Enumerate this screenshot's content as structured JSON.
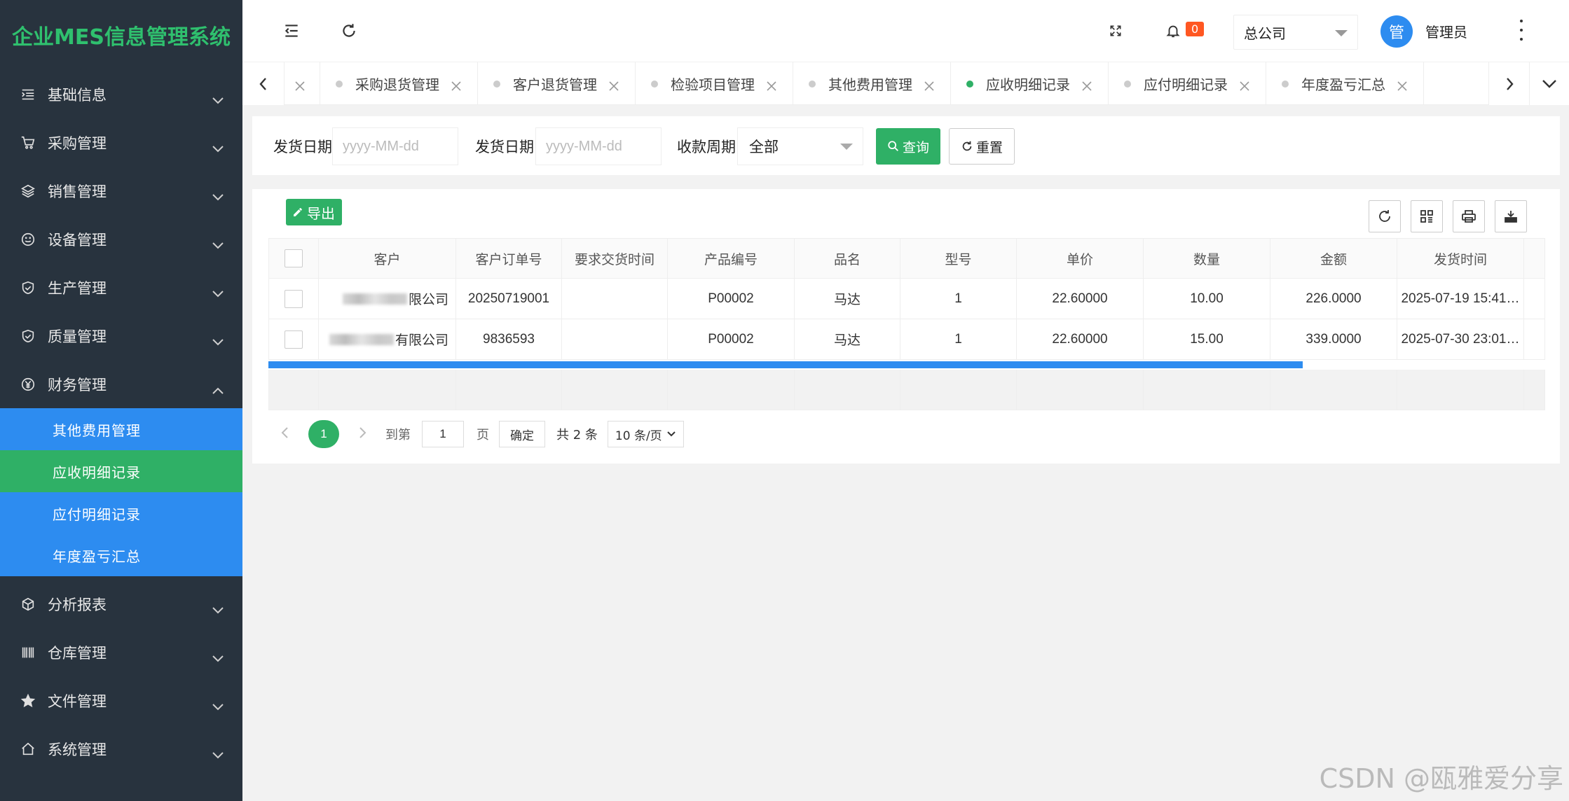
{
  "app": {
    "title": "企业MES信息管理系统"
  },
  "sidebar": {
    "menu_top": [
      {
        "label": "基础信息",
        "icon": "list-indent-icon"
      },
      {
        "label": "采购管理",
        "icon": "cart-icon"
      },
      {
        "label": "销售管理",
        "icon": "layers-icon"
      },
      {
        "label": "设备管理",
        "icon": "smile-icon"
      },
      {
        "label": "生产管理",
        "icon": "shield-check-icon"
      },
      {
        "label": "质量管理",
        "icon": "shield-check-icon"
      },
      {
        "label": "财务管理",
        "icon": "yen-icon"
      }
    ],
    "submenu": [
      {
        "label": "其他费用管理"
      },
      {
        "label": "应收明细记录"
      },
      {
        "label": "应付明细记录"
      },
      {
        "label": "年度盈亏汇总"
      }
    ],
    "menu_bottom": [
      {
        "label": "分析报表",
        "icon": "cube-icon"
      },
      {
        "label": "仓库管理",
        "icon": "barcode-icon"
      },
      {
        "label": "文件管理",
        "icon": "star-icon"
      },
      {
        "label": "系统管理",
        "icon": "home-icon"
      }
    ]
  },
  "header": {
    "notification_count": "0",
    "company": "总公司",
    "avatar_text": "管",
    "username": "管理员"
  },
  "tabs": [
    {
      "label": "采购退货管理"
    },
    {
      "label": "客户退货管理"
    },
    {
      "label": "检验项目管理"
    },
    {
      "label": "其他费用管理"
    },
    {
      "label": "应收明细记录"
    },
    {
      "label": "应付明细记录"
    },
    {
      "label": "年度盈亏汇总"
    }
  ],
  "filters": {
    "ship_date_label_1": "发货日期",
    "ship_date_placeholder_1": "yyyy-MM-dd",
    "ship_date_label_2": "发货日期",
    "ship_date_placeholder_2": "yyyy-MM-dd",
    "period_label": "收款周期",
    "period_value": "全部",
    "search_label": "查询",
    "reset_label": "重置"
  },
  "toolbar": {
    "export_label": "导出"
  },
  "table": {
    "columns": [
      "客户",
      "客户订单号",
      "要求交货时间",
      "产品编号",
      "品名",
      "型号",
      "单价",
      "数量",
      "金额",
      "发货时间"
    ],
    "rows": [
      [
        "限公司",
        "20250719001",
        "",
        "P00002",
        "马达",
        "1",
        "22.60000",
        "10.00",
        "226.0000",
        "2025-07-19 15:41…"
      ],
      [
        "有限公司",
        "9836593",
        "",
        "P00002",
        "马达",
        "1",
        "22.60000",
        "15.00",
        "339.0000",
        "2025-07-30 23:01…"
      ]
    ],
    "horizontal_scroll_fraction": 0.81
  },
  "pagination": {
    "current_page": "1",
    "goto_label": "到第",
    "goto_value": "1",
    "page_suffix": "页",
    "confirm_label": "确定",
    "total_label": "共 2 条",
    "page_size": "10 条/页"
  },
  "watermark": "CSDN @瓯雅爱分享",
  "colors": {
    "sidebar_bg": "#28333e",
    "accent_green": "#2fb066",
    "accent_blue": "#2d8cf0",
    "badge_orange": "#ff5722"
  }
}
